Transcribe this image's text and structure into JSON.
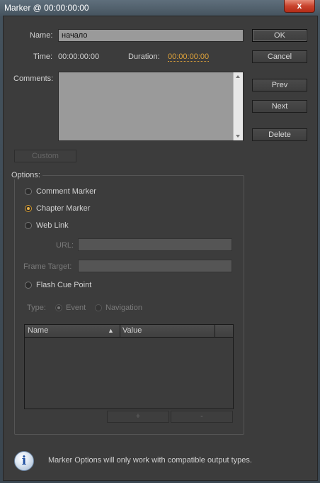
{
  "window": {
    "title": "Marker @ 00:00:00:00",
    "close_glyph": "x"
  },
  "name": {
    "label": "Name:",
    "value": "начало"
  },
  "time": {
    "label": "Time:",
    "value": "00:00:00:00"
  },
  "duration": {
    "label": "Duration:",
    "value": "00:00:00:00"
  },
  "comments": {
    "label": "Comments:",
    "value": ""
  },
  "buttons": {
    "ok": "OK",
    "cancel": "Cancel",
    "prev": "Prev",
    "next": "Next",
    "delete": "Delete",
    "custom": "Custom"
  },
  "options": {
    "label": "Options:",
    "comment_marker": "Comment Marker",
    "chapter_marker": "Chapter Marker",
    "web_link": "Web Link",
    "url_label": "URL:",
    "frame_target_label": "Frame Target:",
    "flash_cue_point": "Flash Cue Point",
    "type_label": "Type:",
    "type_event": "Event",
    "type_navigation": "Navigation",
    "selected": "chapter_marker"
  },
  "table": {
    "columns": [
      "Name",
      "Value"
    ],
    "sort_glyph": "▲",
    "add_label": "+",
    "remove_label": "-"
  },
  "info": {
    "message": "Marker Options will only work with compatible output types."
  },
  "colors": {
    "accent": "#e0a33a",
    "panel": "#3c3c3c"
  }
}
